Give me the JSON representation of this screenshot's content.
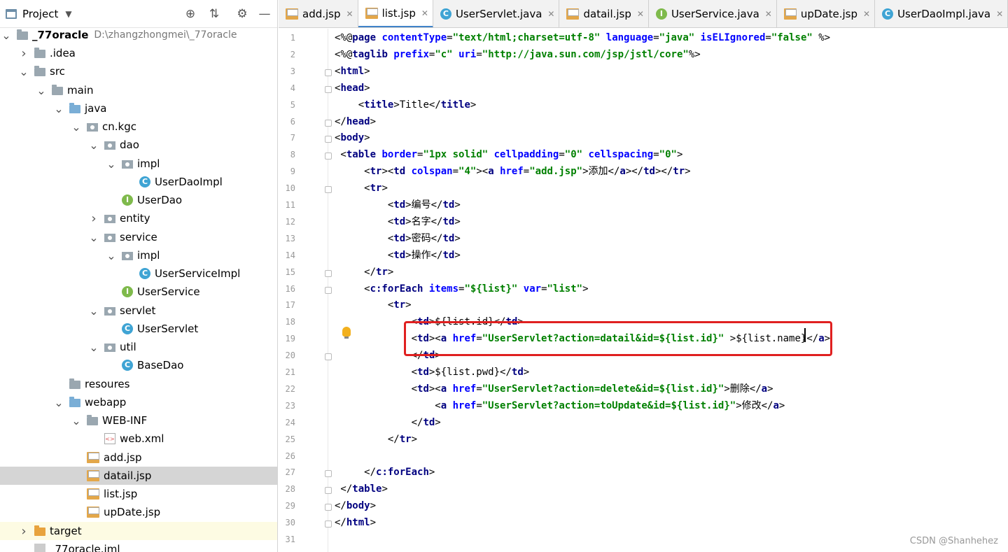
{
  "project_panel": {
    "title": "Project",
    "tree": [
      {
        "label": "_77oracle",
        "path": "D:\\zhangzhongmei\\_77oracle",
        "icon": "folder-icon",
        "level": 0,
        "expanded": true
      },
      {
        "label": ".idea",
        "icon": "folder-icon",
        "level": 1,
        "expanded": false
      },
      {
        "label": "src",
        "icon": "folder-icon",
        "level": 1,
        "expanded": true
      },
      {
        "label": "main",
        "icon": "folder-icon",
        "level": 2,
        "expanded": true
      },
      {
        "label": "java",
        "icon": "source-folder-icon",
        "level": 3,
        "expanded": true
      },
      {
        "label": "cn.kgc",
        "icon": "package-icon",
        "level": 4,
        "expanded": true
      },
      {
        "label": "dao",
        "icon": "package-icon",
        "level": 5,
        "expanded": true
      },
      {
        "label": "impl",
        "icon": "package-icon",
        "level": 6,
        "expanded": true
      },
      {
        "label": "UserDaoImpl",
        "icon": "class-icon",
        "level": 7
      },
      {
        "label": "UserDao",
        "icon": "interface-icon",
        "level": 6
      },
      {
        "label": "entity",
        "icon": "package-icon",
        "level": 5,
        "expanded": false
      },
      {
        "label": "service",
        "icon": "package-icon",
        "level": 5,
        "expanded": true
      },
      {
        "label": "impl",
        "icon": "package-icon",
        "level": 6,
        "expanded": true
      },
      {
        "label": "UserServiceImpl",
        "icon": "class-icon",
        "level": 7
      },
      {
        "label": "UserService",
        "icon": "interface-icon",
        "level": 6
      },
      {
        "label": "servlet",
        "icon": "package-icon",
        "level": 5,
        "expanded": true
      },
      {
        "label": "UserServlet",
        "icon": "class-icon",
        "level": 6
      },
      {
        "label": "util",
        "icon": "package-icon",
        "level": 5,
        "expanded": true
      },
      {
        "label": "BaseDao",
        "icon": "class-icon",
        "level": 6
      },
      {
        "label": "resoures",
        "icon": "folder-icon",
        "level": 3
      },
      {
        "label": "webapp",
        "icon": "web-folder-icon",
        "level": 3,
        "expanded": true
      },
      {
        "label": "WEB-INF",
        "icon": "folder-icon",
        "level": 4,
        "expanded": true
      },
      {
        "label": "web.xml",
        "icon": "xml-file-icon",
        "level": 5
      },
      {
        "label": "add.jsp",
        "icon": "jsp-file-icon",
        "level": 4
      },
      {
        "label": "datail.jsp",
        "icon": "jsp-file-icon",
        "level": 4,
        "selected": true
      },
      {
        "label": "list.jsp",
        "icon": "jsp-file-icon",
        "level": 4
      },
      {
        "label": "upDate.jsp",
        "icon": "jsp-file-icon",
        "level": 4
      },
      {
        "label": "target",
        "icon": "excluded-folder-icon",
        "level": 1,
        "expanded": false,
        "highlight": true
      },
      {
        "label": "_77oracle.iml",
        "icon": "iml-file-icon",
        "level": 1
      }
    ]
  },
  "tabs": [
    {
      "label": "add.jsp",
      "icon": "jsp-file-icon"
    },
    {
      "label": "list.jsp",
      "icon": "jsp-file-icon",
      "active": true
    },
    {
      "label": "UserServlet.java",
      "icon": "class-icon"
    },
    {
      "label": "datail.jsp",
      "icon": "jsp-file-icon"
    },
    {
      "label": "UserService.java",
      "icon": "interface-icon"
    },
    {
      "label": "upDate.jsp",
      "icon": "jsp-file-icon"
    },
    {
      "label": "UserDaoImpl.java",
      "icon": "class-icon"
    }
  ],
  "editor": {
    "line_numbers": [
      "1",
      "2",
      "3",
      "4",
      "5",
      "6",
      "7",
      "8",
      "9",
      "10",
      "11",
      "12",
      "13",
      "14",
      "15",
      "16",
      "17",
      "18",
      "19",
      "20",
      "21",
      "22",
      "23",
      "24",
      "25",
      "26",
      "27",
      "28",
      "29",
      "30",
      "31"
    ],
    "lines": [
      "<%@page contentType=\"text/html;charset=utf-8\" language=\"java\" isELIgnored=\"false\" %>",
      "<%@taglib prefix=\"c\" uri=\"http://java.sun.com/jsp/jstl/core\"%>",
      "<html>",
      "<head>",
      "    <title>Title</title>",
      "</head>",
      "<body>",
      " <table border=\"1px solid\" cellpadding=\"0\" cellspacing=\"0\">",
      "     <tr><td colspan=\"4\"><a href=\"add.jsp\">添加</a></td></tr>",
      "     <tr>",
      "         <td>编号</td>",
      "         <td>名字</td>",
      "         <td>密码</td>",
      "         <td>操作</td>",
      "     </tr>",
      "     <c:forEach items=\"${list}\" var=\"list\">",
      "         <tr>",
      "             <td>${list.id}</td>",
      "             <td><a href=\"UserServlet?action=datail&id=${list.id}\" >${list.name}</a>",
      "             </td>",
      "             <td>${list.pwd}</td>",
      "             <td><a href=\"UserServlet?action=delete&id=${list.id}\">删除</a>",
      "                 <a href=\"UserServlet?action=toUpdate&id=${list.id}\">修改</a>",
      "             </td>",
      "         </tr>",
      "",
      "     </c:forEach>",
      " </table>",
      "</body>",
      "</html>",
      ""
    ]
  },
  "watermark": "CSDN @Shanhehez",
  "colors": {
    "highlight_box": "#e02020",
    "active_tab_accent": "#4083c9"
  }
}
